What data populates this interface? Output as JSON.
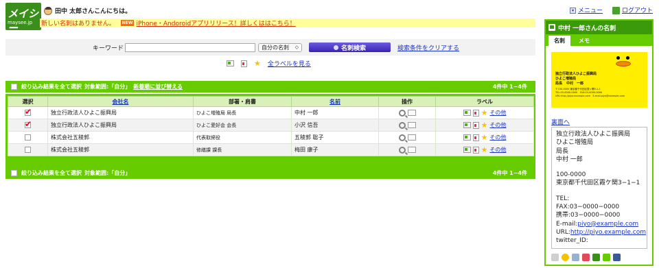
{
  "header": {
    "logo_title": "メイシー",
    "logo_domain": "maysee.jp",
    "greeting": "田中 太郎さんこんにちは。",
    "notice_text": "新しい名刺はありません。",
    "notice_badge": "NEW",
    "notice_link": "iPhone・Andoroidアプリリリース！詳しくははこちら！",
    "menu_link": "メニュー",
    "logout_link": "ログアウト"
  },
  "search": {
    "keyword_label": "キーワード",
    "keyword_value": "",
    "scope_selected": "自分の名刺",
    "search_button": "名刺検索",
    "clear_link": "検索条件をクリアする",
    "all_labels_link": "全ラベルを見る"
  },
  "bar_top": {
    "select_all": "絞り込み結果を全て選択",
    "scope_text": "対象範囲:「自分」",
    "sort_link": "新着順に並び替える",
    "count": "4件中 1−4件"
  },
  "bar_bottom": {
    "select_all": "絞り込み結果を全て選択",
    "scope_text": "対象範囲:「自分」",
    "count": "4件中 1−4件"
  },
  "table": {
    "headers": {
      "select": "選択",
      "company": "会社名",
      "dept": "部署・肩書",
      "name": "名前",
      "ops": "操作",
      "label": "ラベル"
    },
    "rows": [
      {
        "checked": true,
        "company": "独立行政法人ひよこ振興局",
        "dept": "ひよこ増殖局 局長",
        "name": "中村 一郎",
        "other": "その他"
      },
      {
        "checked": true,
        "company": "独立行政法人ひよこ振興局",
        "dept": "ひよこ愛好会 会長",
        "name": "小沢 信吾",
        "other": "その他"
      },
      {
        "checked": false,
        "company": "株式会社五稜郭",
        "dept": "代表取締役",
        "name": "五稜郭 聡子",
        "other": "その他"
      },
      {
        "checked": false,
        "company": "株式会社五稜郭",
        "dept": "修繕課 課長",
        "name": "梅田 康子",
        "other": "その他"
      }
    ]
  },
  "panel": {
    "title": "中村 一郎さんの名刺",
    "tab_card": "名刺",
    "tab_memo": "メモ",
    "card": {
      "org1": "独立行政法人ひよこ振興局",
      "org2": "ひよこ増殖局",
      "role": "局長",
      "name": "中村　一郎",
      "addr": "〒100-0000 東京都千代田区霞ヶ関3-1-1",
      "tel": "TEL:03-0000-0000　FAX:03-0000-0000",
      "url": "URL:http://piyo.example.com　E-mail:piyo@example.com"
    },
    "back_link": "裏面へ",
    "info": {
      "company": "独立行政法人ひよこ振興局",
      "dept": "ひよこ増殖局",
      "title": "局長",
      "name": "中村 一郎",
      "zip": "100-0000",
      "address": "東京都千代田区霞ケ関3−1−1",
      "tel": "TEL:",
      "fax": "FAX:03−0000−0000",
      "mobile": "携帯:03−0000−0000",
      "email_label": "E-mail:",
      "email": "piyo@example.com",
      "url_label": "URL:",
      "url": "http://piyo.example.com",
      "twitter": "twitter_ID:"
    },
    "colors": {
      "accent": "#66cc00",
      "header": "#3a9a0a",
      "card": "#ffee00"
    }
  }
}
